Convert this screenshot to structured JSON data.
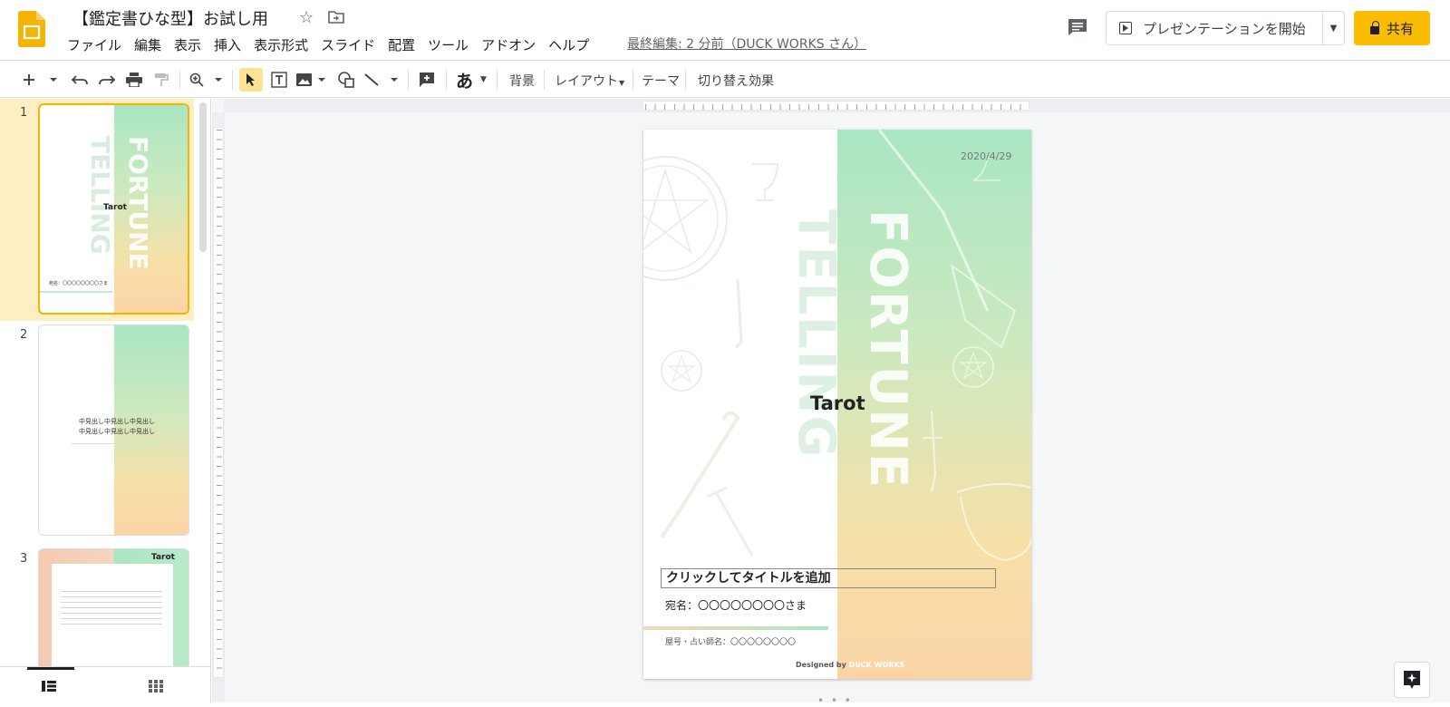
{
  "header": {
    "doc_title": "【鑑定書ひな型】お試し用",
    "menu": [
      "ファイル",
      "編集",
      "表示",
      "挿入",
      "表示形式",
      "スライド",
      "配置",
      "ツール",
      "アドオン",
      "ヘルプ"
    ],
    "last_edit": "最終編集: 2 分前（DUCK WORKS さん）",
    "present_label": "プレゼンテーションを開始",
    "share_label": "共有"
  },
  "toolbar": {
    "background_label": "背景",
    "layout_label": "レイアウト",
    "theme_label": "テーマ",
    "transition_label": "切り替え効果",
    "text_style_glyph": "あ"
  },
  "sidebar": {
    "slides": [
      {
        "number": "1",
        "tarot": "Tarot",
        "word1": "FORTUNE",
        "word2": "TELLING",
        "recipient": "宛名：〇〇〇〇〇〇〇〇さま"
      },
      {
        "number": "2",
        "heading1": "中見出し中見出し中見出し",
        "heading2": "中見出し中見出し中見出し"
      },
      {
        "number": "3",
        "tarot": "Tarot"
      }
    ]
  },
  "slide": {
    "date": "2020/4/29",
    "word_fortune": "FORTUNE",
    "word_telling": "TELLING",
    "tarot": "Tarot",
    "title_placeholder": "クリックしてタイトルを追加",
    "recipient": "宛名：〇〇〇〇〇〇〇〇さま",
    "reader": "屋号・占い師名：〇〇〇〇〇〇〇〇",
    "credit_prefix": "Designed by",
    "credit_brand": "DUCK WORKS"
  },
  "colors": {
    "accent": "#fbbc04",
    "selection": "#feefc3",
    "grad_top": "#a9e6c3",
    "grad_bottom": "#fcd4a6"
  },
  "icons": [
    "slides-logo-icon",
    "star-icon",
    "move-to-folder-icon",
    "comments-icon",
    "present-icon",
    "lock-icon",
    "new-slide-icon",
    "undo-icon",
    "redo-icon",
    "print-icon",
    "paint-format-icon",
    "zoom-icon",
    "select-icon",
    "text-box-icon",
    "image-icon",
    "shape-icon",
    "line-icon",
    "comment-add-icon",
    "chevron-up-icon",
    "filmstrip-view-icon",
    "grid-view-icon",
    "explore-icon"
  ]
}
